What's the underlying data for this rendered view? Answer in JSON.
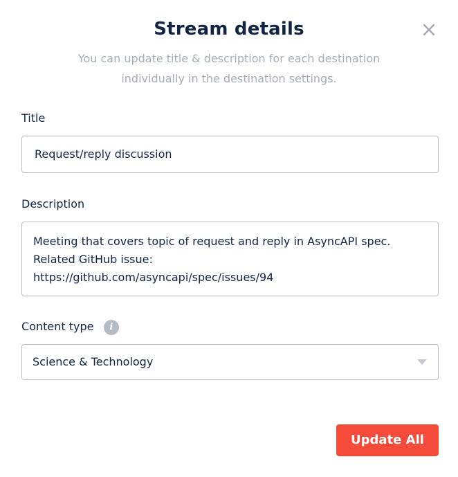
{
  "dialog": {
    "title": "Stream details",
    "subtitle_lines": [
      "You can update title & description for each destination",
      "individually in the destination settings."
    ]
  },
  "fields": {
    "title_label": "Title",
    "title_value": "Request/reply discussion",
    "description_label": "Description",
    "description_lines": [
      "Meeting that covers topic of request and reply in AsyncAPI spec.",
      "Related GitHub issue:",
      "https://github.com/asyncapi/spec/issues/94"
    ],
    "content_type_label": "Content type",
    "content_type_value": "Science & Technology"
  },
  "actions": {
    "update_all_label": "Update All"
  },
  "icons": {
    "close": "close-icon",
    "info": "info-icon",
    "dropdown": "chevron-down-icon"
  },
  "colors": {
    "heading": "#122344",
    "muted": "#a7adb7",
    "primary_button": "#f44b3a",
    "border": "#b7bcc4"
  }
}
